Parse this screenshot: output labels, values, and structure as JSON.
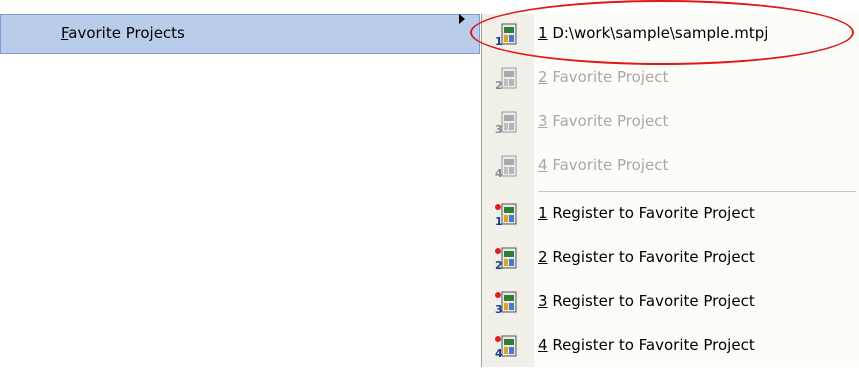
{
  "parent_menu": {
    "label_accel": "F",
    "label_rest": "avorite Projects"
  },
  "submenu": {
    "items": [
      {
        "accel": "1",
        "text": " D:\\work\\sample\\sample.mtpj",
        "enabled": true,
        "icon": "project-icon"
      },
      {
        "accel": "2",
        "text": " Favorite Project",
        "enabled": false,
        "icon": "project-icon"
      },
      {
        "accel": "3",
        "text": " Favorite Project",
        "enabled": false,
        "icon": "project-icon"
      },
      {
        "accel": "4",
        "text": " Favorite Project",
        "enabled": false,
        "icon": "project-icon"
      },
      {
        "accel": "1",
        "text": " Register to Favorite Project",
        "enabled": true,
        "icon": "register-project-icon"
      },
      {
        "accel": "2",
        "text": " Register to Favorite Project",
        "enabled": true,
        "icon": "register-project-icon"
      },
      {
        "accel": "3",
        "text": " Register to Favorite Project",
        "enabled": true,
        "icon": "register-project-icon"
      },
      {
        "accel": "4",
        "text": " Register to Favorite Project",
        "enabled": true,
        "icon": "register-project-icon"
      }
    ]
  },
  "colors": {
    "highlight": "#b9cdeb",
    "annotation_oval": "#e01818",
    "disabled_text": "#a8a8a8"
  }
}
